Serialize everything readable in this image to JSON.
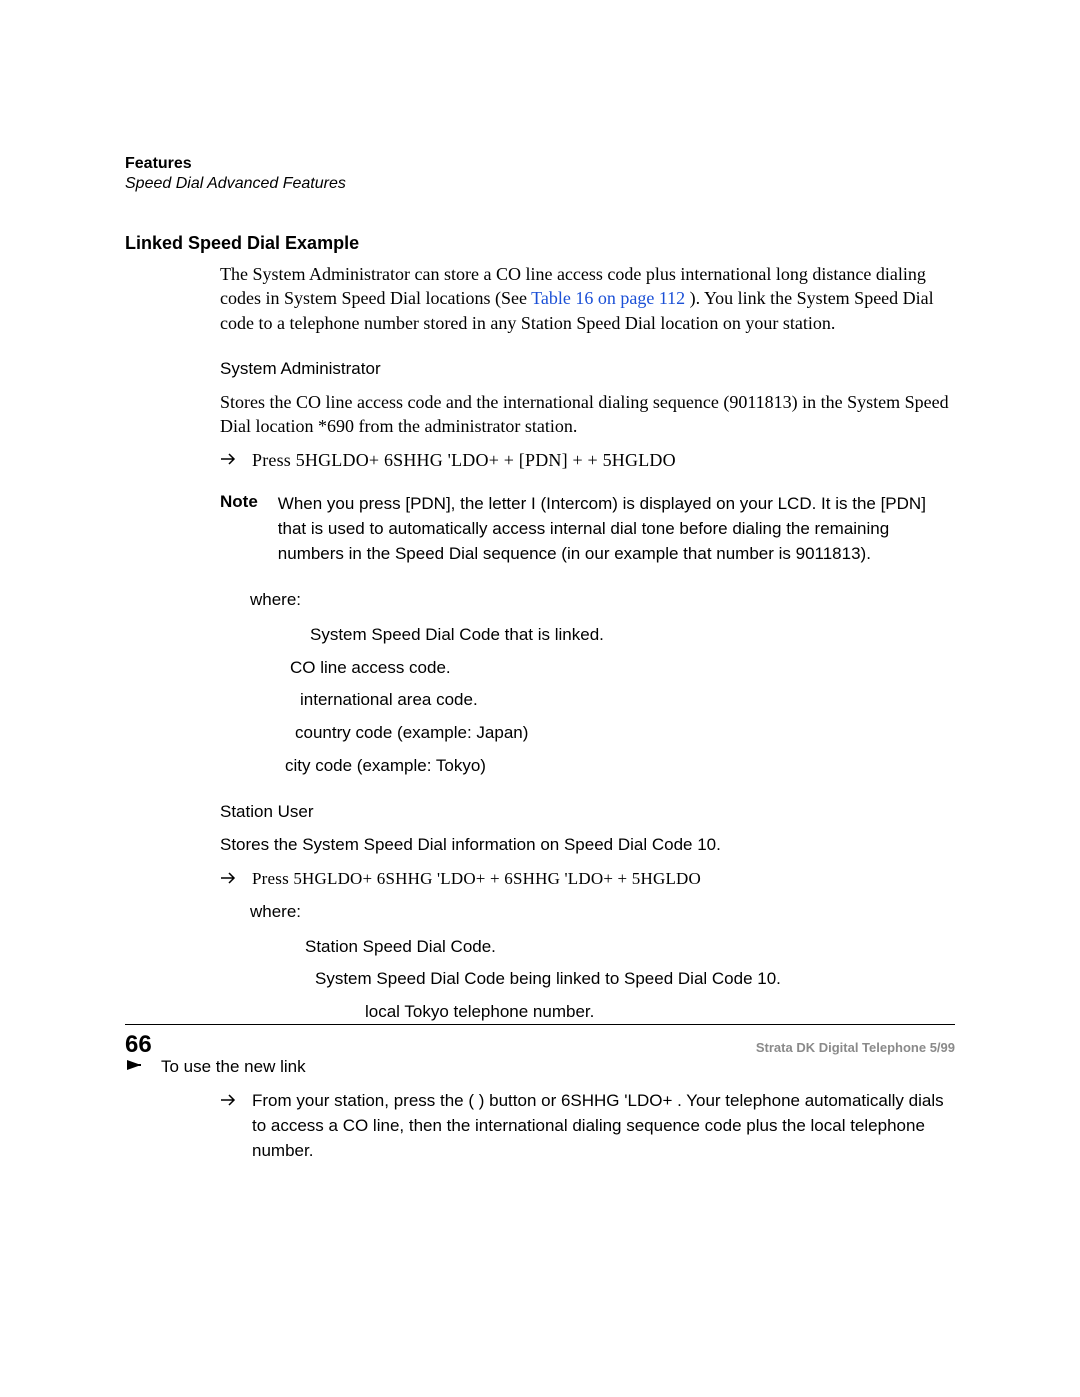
{
  "header": {
    "title": "Features",
    "subtitle": "Speed Dial Advanced Features"
  },
  "section": {
    "heading": "Linked Speed Dial Example",
    "intro_a": "The System Administrator can store a CO line access code plus international long distance dialing codes in System Speed Dial locations (See ",
    "intro_link": "Table 16 on page 112",
    "intro_b": "). You link the System Speed Dial code to a telephone number stored in any Station Speed Dial location on your station."
  },
  "sysadmin": {
    "title": "System Administrator",
    "desc": "Stores the CO line access code and the international dialing sequence (9011813) in the System Speed Dial location *690 from the administrator station.",
    "press": "Press 5HGLDO+ 6SHHG 'LDO+        + [PDN] +                 + 5HGLDO"
  },
  "note": {
    "label": "Note",
    "text": "When you press [PDN], the letter  I  (Intercom) is displayed on your LCD. It is the [PDN] that is used to automatically access internal dial tone before dialing the remaining numbers in the Speed Dial sequence (in our example that number is 9011813)."
  },
  "where": {
    "label": "where:",
    "items": [
      "System Speed Dial Code that is linked.",
      "CO line access code.",
      "international area code.",
      "country code (example: Japan)",
      "city code (example: Tokyo)"
    ]
  },
  "stationuser": {
    "title": "Station User",
    "desc": "Stores the System Speed Dial information on Speed Dial Code 10.",
    "press": "Press 5HGLDO+ 6SHHG 'LDO+      + 6SHHG 'LDO+                        + 5HGLDO",
    "where": "where:",
    "items": [
      "Station Speed Dial Code.",
      "System Speed Dial Code being linked to Speed Dial Code 10.",
      "local Tokyo telephone number."
    ]
  },
  "uselink": {
    "heading": "To use the new link",
    "text": "From your station, press the   (    )  button or 6SHHG 'LDO+       . Your telephone automatically dials  to access a CO line, then the international dialing sequence code plus the local telephone number."
  },
  "footer": {
    "page": "66",
    "source": "Strata DK Digital Telephone   5/99"
  }
}
